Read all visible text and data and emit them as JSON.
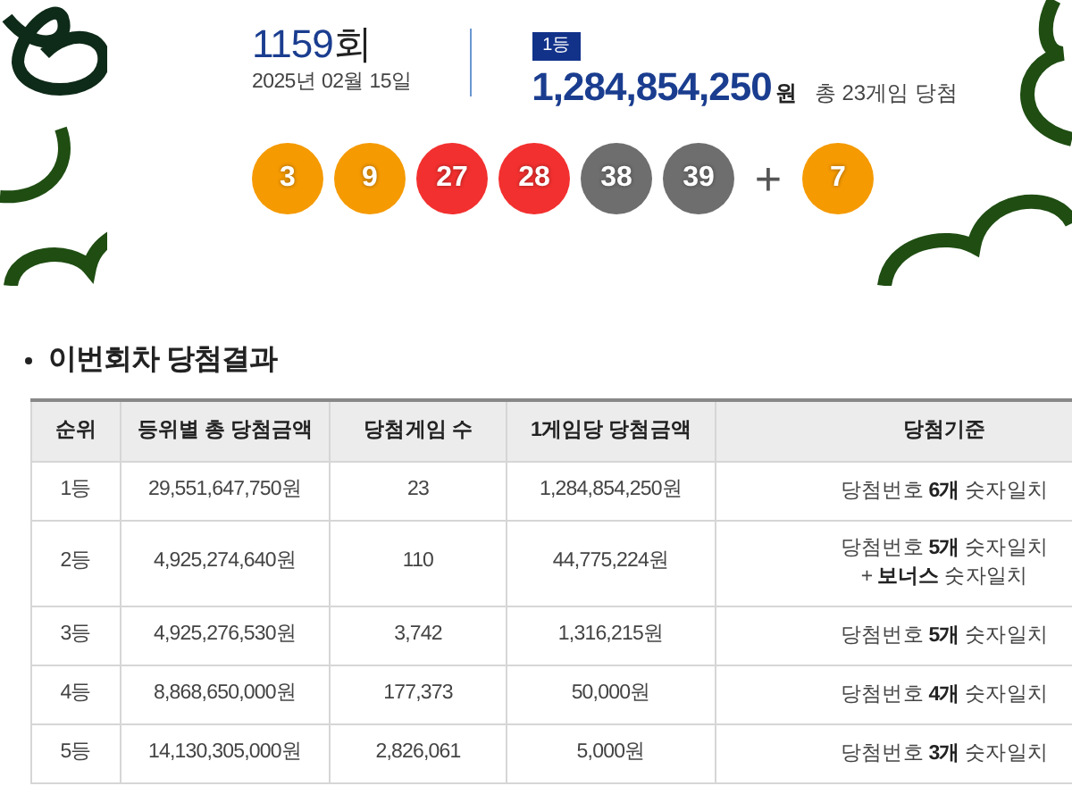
{
  "draw": {
    "round": "1159",
    "round_suffix": "회",
    "date": "2025년 02월 15일",
    "rank_badge": "1등",
    "amount": "1,284,854,250",
    "amount_unit": "원",
    "winners": "총 23게임 당첨",
    "balls": [
      {
        "number": "3",
        "color": "#f59a00"
      },
      {
        "number": "9",
        "color": "#f59a00"
      },
      {
        "number": "27",
        "color": "#f2302f"
      },
      {
        "number": "28",
        "color": "#f2302f"
      },
      {
        "number": "38",
        "color": "#6e6e6e"
      },
      {
        "number": "39",
        "color": "#6e6e6e"
      }
    ],
    "plus": "+",
    "bonus": {
      "number": "7",
      "color": "#f59a00"
    }
  },
  "results": {
    "title": "이번회차 당첨결과",
    "columns": [
      "순위",
      "등위별 총 당첨금액",
      "당첨게임 수",
      "1게임당 당첨금액",
      "당첨기준"
    ],
    "rows": [
      {
        "rank": "1등",
        "total": "29,551,647,750원",
        "games": "23",
        "per_game": "1,284,854,250원",
        "criteria": [
          "당첨번호 **6개** 숫자일치"
        ]
      },
      {
        "rank": "2등",
        "total": "4,925,274,640원",
        "games": "110",
        "per_game": "44,775,224원",
        "criteria": [
          "당첨번호 **5개** 숫자일치",
          "+ **보너스** 숫자일치"
        ]
      },
      {
        "rank": "3등",
        "total": "4,925,276,530원",
        "games": "3,742",
        "per_game": "1,316,215원",
        "criteria": [
          "당첨번호 **5개** 숫자일치"
        ]
      },
      {
        "rank": "4등",
        "total": "8,868,650,000원",
        "games": "177,373",
        "per_game": "50,000원",
        "criteria": [
          "당첨번호 **4개** 숫자일치"
        ]
      },
      {
        "rank": "5등",
        "total": "14,130,305,000원",
        "games": "2,826,061",
        "per_game": "5,000원",
        "criteria": [
          "당첨번호 **3개** 숫자일치"
        ]
      }
    ]
  }
}
